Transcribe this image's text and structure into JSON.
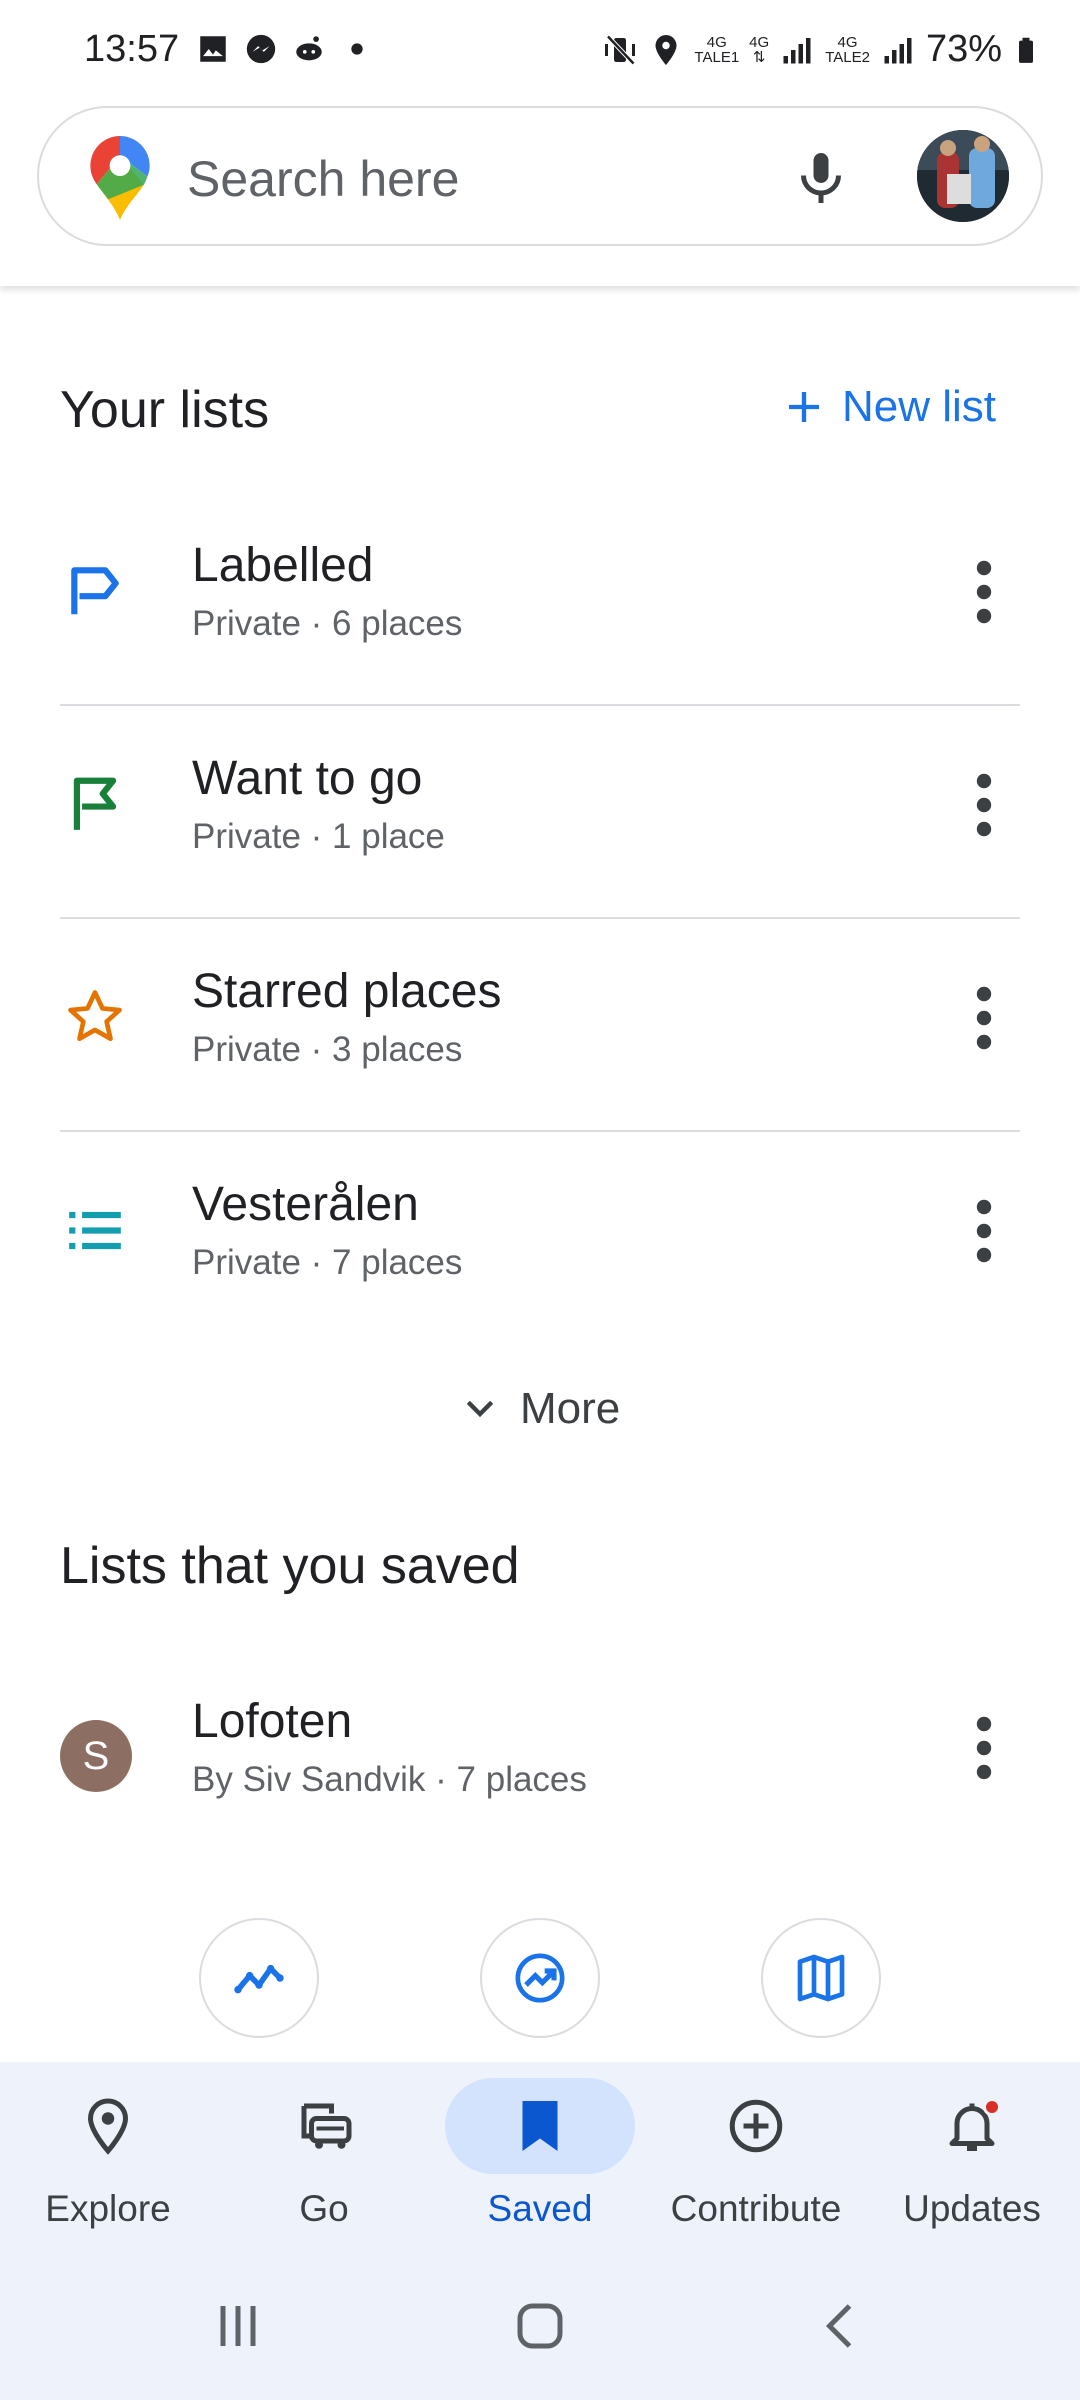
{
  "status_bar": {
    "time": "13:57",
    "net1": "4G",
    "net1_sub": "TALE1",
    "net2": "4G",
    "net3": "4G",
    "net3_sub": "TALE2",
    "battery": "73%"
  },
  "search": {
    "placeholder": "Search here"
  },
  "your_lists": {
    "title": "Your lists",
    "new_list_label": "New list",
    "items": [
      {
        "title": "Labelled",
        "subtitle": "Private · 6 places",
        "icon": "label-flag-icon",
        "color": "#1a73e8"
      },
      {
        "title": "Want to go",
        "subtitle": "Private · 1 place",
        "icon": "flag-icon",
        "color": "#188038"
      },
      {
        "title": "Starred places",
        "subtitle": "Private · 3 places",
        "icon": "star-icon",
        "color": "#e37400"
      },
      {
        "title": "Vesterålen",
        "subtitle": "Private · 7 places",
        "icon": "list-icon",
        "color": "#129eaf"
      }
    ],
    "more_label": "More"
  },
  "saved_lists": {
    "title": "Lists that you saved",
    "items": [
      {
        "avatar_letter": "S",
        "title": "Lofoten",
        "subtitle": "By Siv Sandvik · 7 places"
      }
    ]
  },
  "action_buttons": [
    "timeline-icon",
    "trending-icon",
    "map-icon"
  ],
  "bottom_nav": {
    "items": [
      {
        "label": "Explore",
        "icon": "location-pin-icon"
      },
      {
        "label": "Go",
        "icon": "car-icon"
      },
      {
        "label": "Saved",
        "icon": "bookmark-icon",
        "active": true
      },
      {
        "label": "Contribute",
        "icon": "add-circle-icon"
      },
      {
        "label": "Updates",
        "icon": "bell-icon",
        "badge": true
      }
    ]
  },
  "colors": {
    "accent": "#1a73e8",
    "active_nav": "#0b57d0",
    "nav_bg": "#eef2fb",
    "pill_bg": "#d3e3fd"
  }
}
